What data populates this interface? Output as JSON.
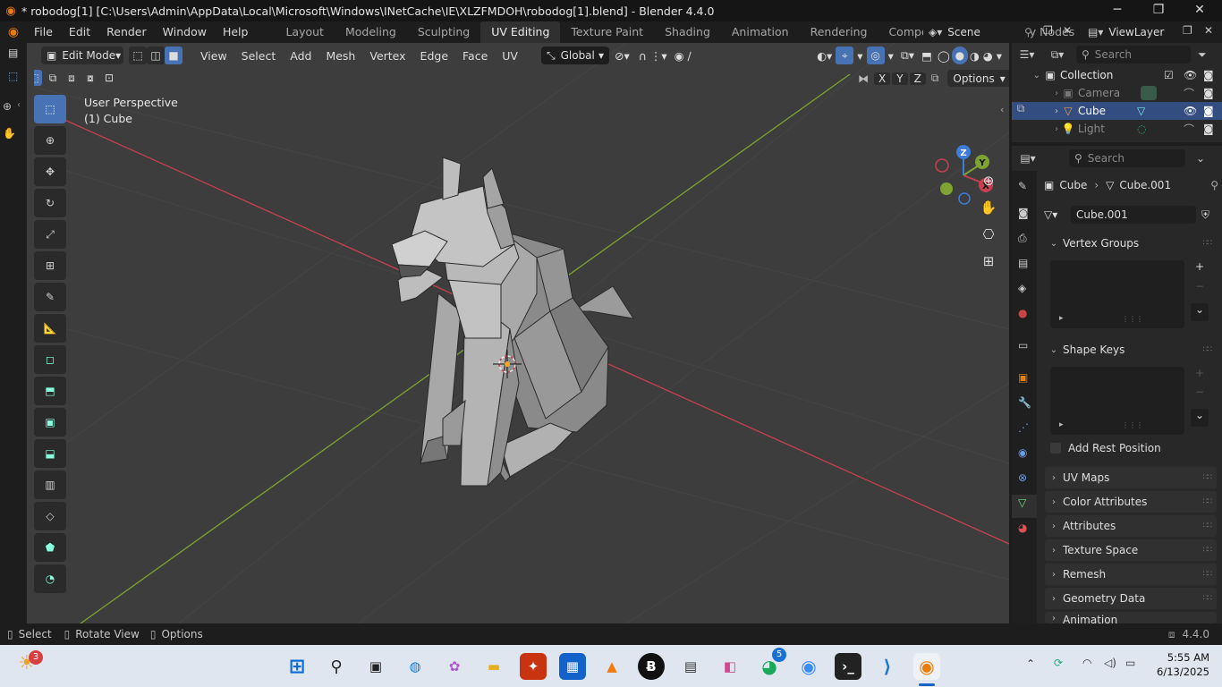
{
  "window": {
    "title": "* robodog[1] [C:\\Users\\Admin\\AppData\\Local\\Microsoft\\Windows\\INetCache\\IE\\XLZFMDOH\\robodog[1].blend] - Blender 4.4.0",
    "minimize": "─",
    "maximize": "❐",
    "close": "✕"
  },
  "menu": [
    "File",
    "Edit",
    "Render",
    "Window",
    "Help"
  ],
  "workspaces": [
    "Layout",
    "Modeling",
    "Sculpting",
    "UV Editing",
    "Texture Paint",
    "Shading",
    "Animation",
    "Rendering",
    "Compositing",
    "Geometry Nodes"
  ],
  "active_workspace": "UV Editing",
  "scene": "Scene",
  "view_layer": "ViewLayer",
  "viewport": {
    "mode": "Edit Mode",
    "menus": [
      "View",
      "Select",
      "Add",
      "Mesh",
      "Vertex",
      "Edge",
      "Face",
      "UV"
    ],
    "orientation": "Global",
    "overlay_text_1": "User Perspective",
    "overlay_text_2": "(1) Cube",
    "mirror_axes": [
      "X",
      "Y",
      "Z"
    ],
    "options": "Options",
    "gizmo": {
      "z": "Z",
      "y": "Y",
      "x": "X"
    }
  },
  "outliner": {
    "search_placeholder": "Search",
    "collection": "Collection",
    "items": [
      {
        "name": "Camera",
        "selected": false
      },
      {
        "name": "Cube",
        "selected": true
      },
      {
        "name": "Light",
        "selected": false
      }
    ]
  },
  "properties": {
    "search_placeholder": "Search",
    "breadcrumb_object": "Cube",
    "breadcrumb_data": "Cube.001",
    "data_name": "Cube.001",
    "panels_open": [
      "Vertex Groups",
      "Shape Keys"
    ],
    "add_rest_position": "Add Rest Position",
    "panels_closed": [
      "UV Maps",
      "Color Attributes",
      "Attributes",
      "Texture Space",
      "Remesh",
      "Geometry Data",
      "Animation"
    ]
  },
  "statusbar": {
    "select": "Select",
    "rotate": "Rotate View",
    "options": "Options",
    "version": "4.4.0"
  },
  "taskbar": {
    "weather_badge": "3",
    "whatsapp_badge": "5",
    "time": "5:55 AM",
    "date": "6/13/2025"
  },
  "colors": {
    "accent": "#4772b3",
    "viewport_bg": "#3d3d3d",
    "x_axis": "#c6414f",
    "y_axis": "#7ea330",
    "blender_orange": "#e87d0d"
  }
}
